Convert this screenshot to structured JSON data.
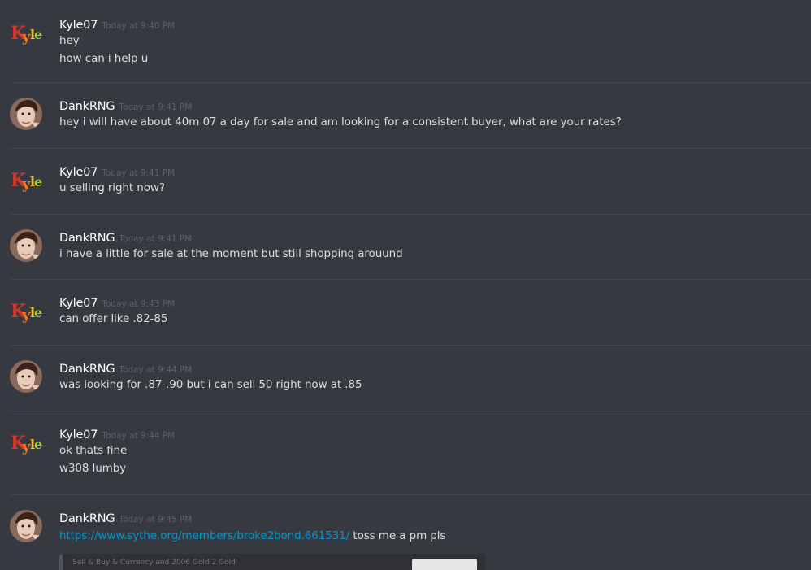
{
  "messages": [
    {
      "author": "Kyle07",
      "time": "Today at 9:40 PM",
      "avatar": "kyle-logo",
      "lines": [
        "hey",
        "how can i help u"
      ]
    },
    {
      "author": "DankRNG",
      "time": "Today at 9:41 PM",
      "avatar": "face-photo",
      "lines": [
        "hey i will have about 40m 07 a day for sale and am looking for a consistent buyer, what are your rates?"
      ]
    },
    {
      "author": "Kyle07",
      "time": "Today at 9:41 PM",
      "avatar": "kyle-logo",
      "lines": [
        "u selling right now?"
      ]
    },
    {
      "author": "DankRNG",
      "time": "Today at 9:41 PM",
      "avatar": "face-photo",
      "lines": [
        "i have a little for sale at the moment but still shopping arouund"
      ]
    },
    {
      "author": "Kyle07",
      "time": "Today at 9:43 PM",
      "avatar": "kyle-logo",
      "lines": [
        "can offer like .82-85"
      ]
    },
    {
      "author": "DankRNG",
      "time": "Today at 9:44 PM",
      "avatar": "face-photo",
      "lines": [
        "was looking for .87-.90 but i can sell 50 right now at .85"
      ]
    },
    {
      "author": "Kyle07",
      "time": "Today at 9:44 PM",
      "avatar": "kyle-logo",
      "lines": [
        "ok thats fine",
        "w308 lumby"
      ]
    },
    {
      "author": "DankRNG",
      "time": "Today at 9:45 PM",
      "avatar": "face-photo",
      "link": "https://www.sythe.org/members/broke2bond.661531/",
      "after_link": " toss me a pm pls",
      "embed_text": "Sell & Buy & Currency and 2006 Gold 2 Gold"
    }
  ],
  "avatar_logo_text": "Kyle",
  "colors": {
    "background": "#36393f",
    "username": "#ffffff",
    "timestamp": "#5e6169",
    "text": "#dcddde",
    "link": "#0096cf",
    "divider": "#42454b"
  }
}
